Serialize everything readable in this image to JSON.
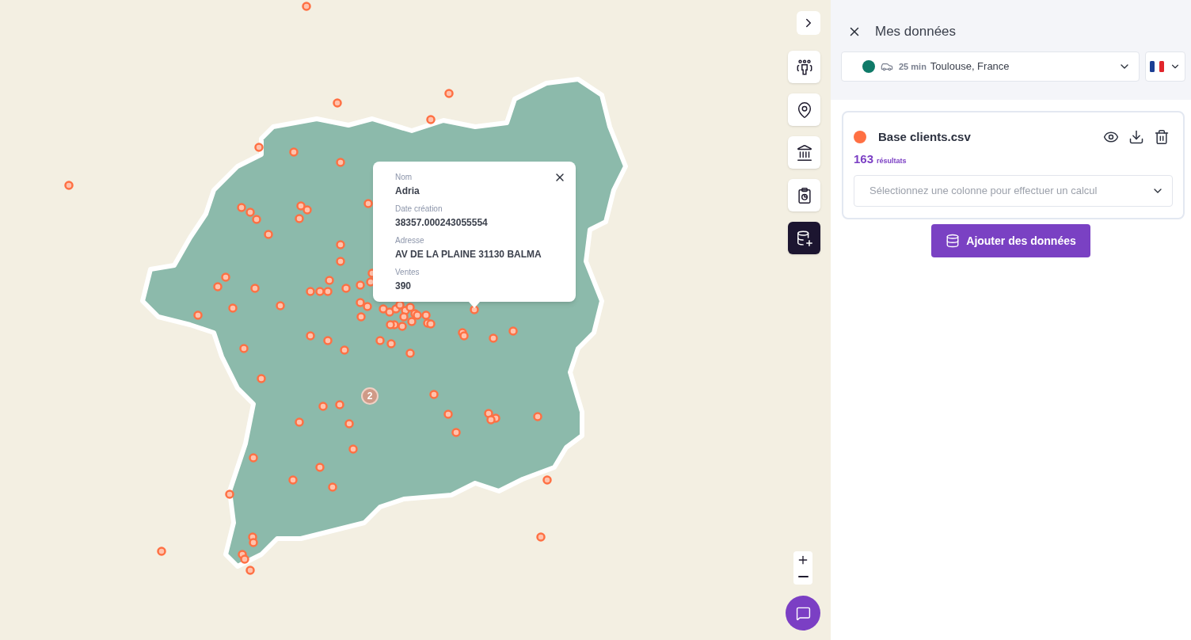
{
  "map": {
    "toolbar": [
      {
        "selected": false
      },
      {
        "selected": false
      },
      {
        "selected": false
      },
      {
        "selected": false
      },
      {
        "selected": true
      }
    ],
    "cluster": {
      "count": "2"
    },
    "popup": {
      "fields": [
        {
          "label": "Nom",
          "value": "Adria"
        },
        {
          "label": "Date création",
          "value": "38357.000243055554"
        },
        {
          "label": "Adresse",
          "value": "AV DE LA PLAINE 31130 BALMA"
        },
        {
          "label": "Ventes",
          "value": "390"
        }
      ]
    }
  },
  "panel": {
    "title": "Mes données",
    "isochrone": {
      "color": "#0f7a68",
      "duration": "25 min",
      "place": "Toulouse, France"
    },
    "dataset": {
      "name": "Base clients.csv",
      "color": "#ff7043",
      "count": "163",
      "count_label": "résultats",
      "calc_placeholder": "Sélectionnez une colonne pour effectuer un calcul"
    },
    "add_button": "Ajouter des données"
  }
}
